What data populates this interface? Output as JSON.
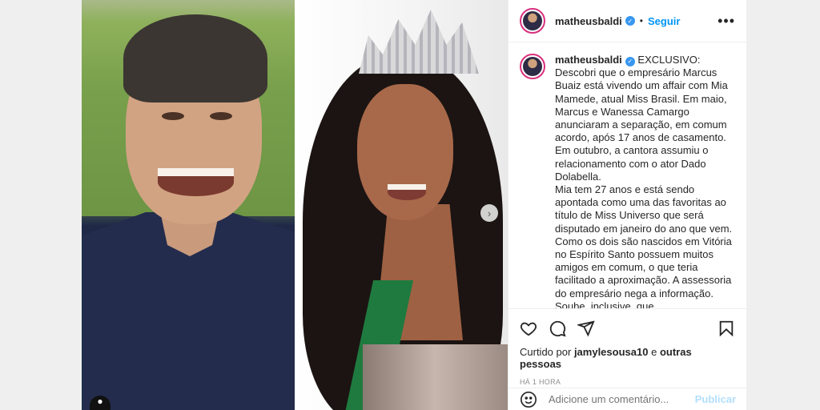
{
  "header": {
    "username": "matheusbaldi",
    "follow_label": "Seguir",
    "separator": "•",
    "more_icon": "more-options-icon"
  },
  "caption": {
    "username": "matheusbaldi",
    "text": "EXCLUSIVO:\nDescobri que o empresário Marcus Buaiz está vivendo um affair com Mia Mamede, atual Miss Brasil. Em maio, Marcus e Wanessa Camargo anunciaram a separação, em comum acordo, após 17 anos de casamento. Em outubro, a cantora assumiu o relacionamento com o ator Dado Dolabella.\nMia tem 27 anos e está sendo apontada como uma das favoritas ao título de Miss Universo que será disputado em janeiro do ano que vem. Como os dois são nascidos em Vitória no Espírito Santo possuem muitos amigos em comum, o que teria facilitado a aproximação. A assessoria do empresário nega a informação. Soube, inclusive, que"
  },
  "likes": {
    "prefix": "Curtido por",
    "user": "jamylesousa10",
    "joiner": "e",
    "others": "outras pessoas"
  },
  "timestamp": "HÁ 1 HORA",
  "comment": {
    "placeholder": "Adicione um comentário...",
    "publish_label": "Publicar"
  },
  "media": {
    "carousel_next_icon": "chevron-right-icon",
    "user_tag_icon": "person-tag-icon"
  },
  "colors": {
    "link_blue": "#0095f6",
    "publish_disabled": "#b2dffc",
    "verified": "#3897f0"
  }
}
